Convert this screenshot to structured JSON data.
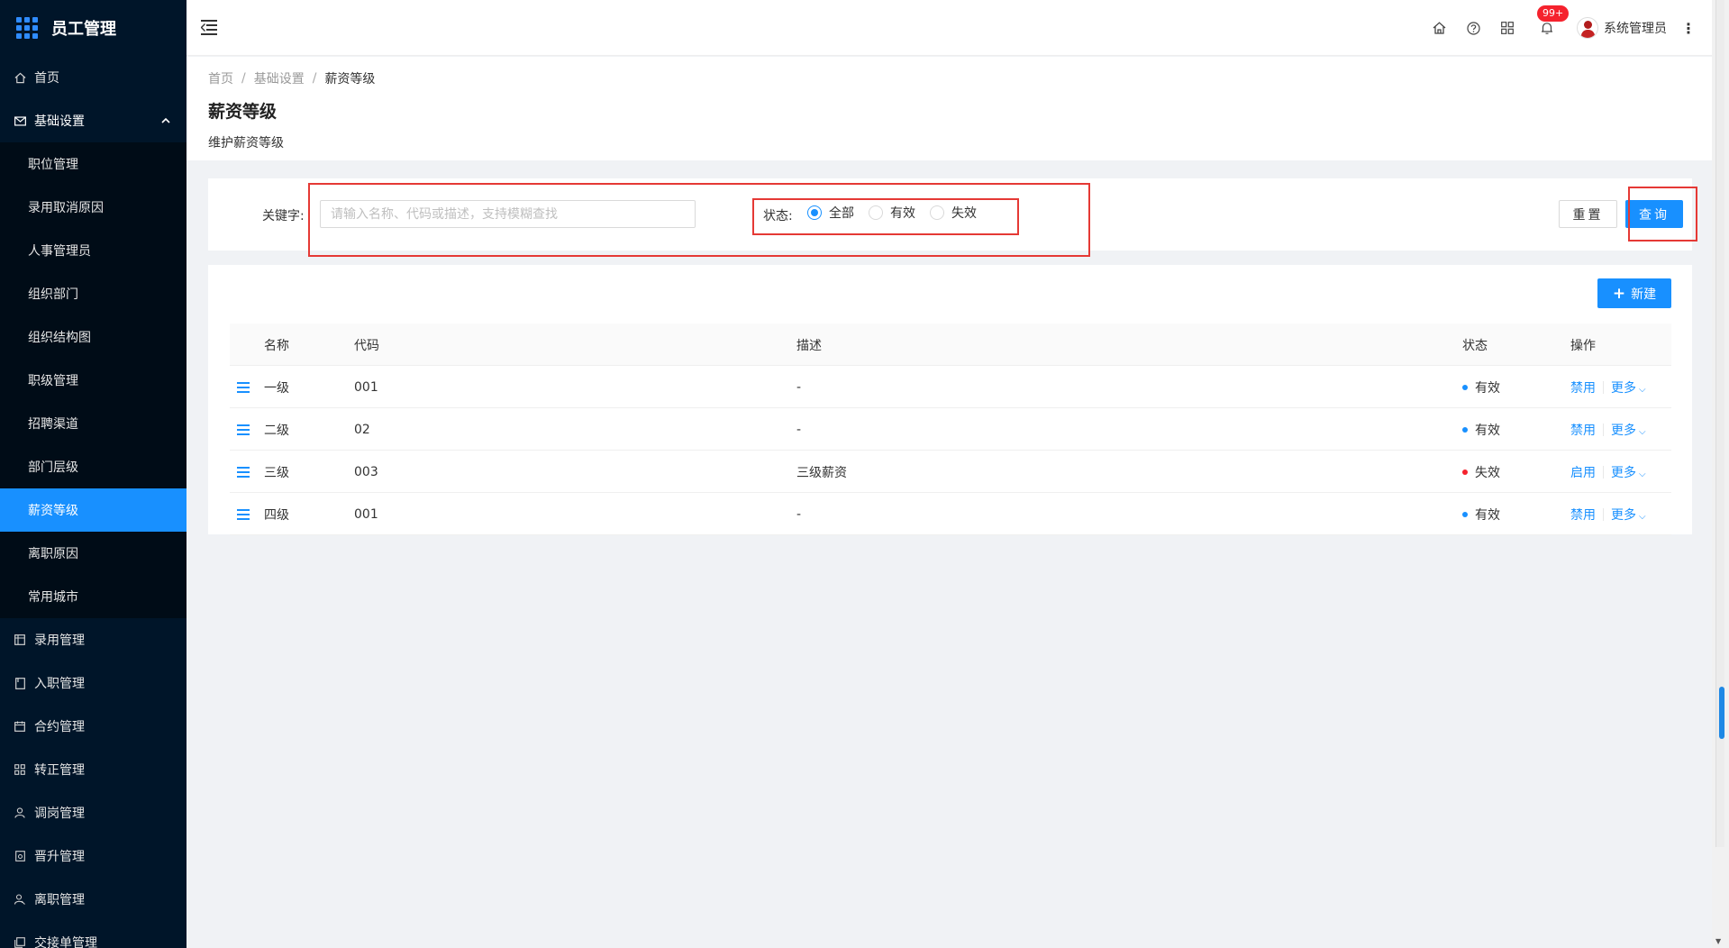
{
  "brand": {
    "title": "员工管理"
  },
  "sidebar": {
    "items": [
      {
        "key": "home",
        "label": "首页",
        "icon": "home-icon"
      },
      {
        "key": "basic",
        "label": "基础设置",
        "icon": "mail-icon",
        "open": true
      }
    ],
    "sub_items": [
      {
        "label": "职位管理"
      },
      {
        "label": "录用取消原因"
      },
      {
        "label": "人事管理员"
      },
      {
        "label": "组织部门"
      },
      {
        "label": "组织结构图"
      },
      {
        "label": "职级管理"
      },
      {
        "label": "招聘渠道"
      },
      {
        "label": "部门层级"
      },
      {
        "label": "薪资等级",
        "active": true
      },
      {
        "label": "离职原因"
      },
      {
        "label": "常用城市"
      }
    ],
    "bottom_items": [
      {
        "label": "录用管理",
        "icon": "calendar-icon"
      },
      {
        "label": "入职管理",
        "icon": "file-icon"
      },
      {
        "label": "合约管理",
        "icon": "calendar-icon"
      },
      {
        "label": "转正管理",
        "icon": "grid-icon"
      },
      {
        "label": "调岗管理",
        "icon": "user-icon"
      },
      {
        "label": "晋升管理",
        "icon": "doc-icon"
      },
      {
        "label": "离职管理",
        "icon": "user-leave-icon"
      },
      {
        "label": "交接单管理",
        "icon": "copy-icon"
      }
    ]
  },
  "header": {
    "notification_badge": "99+",
    "user_name": "系统管理员"
  },
  "breadcrumb": {
    "items": [
      "首页",
      "基础设置"
    ],
    "current": "薪资等级"
  },
  "page": {
    "title": "薪资等级",
    "description": "维护薪资等级"
  },
  "filter": {
    "keyword_label": "关键字:",
    "keyword_placeholder": "请输入名称、代码或描述，支持模糊查找",
    "keyword_value": "",
    "status_label": "状态:",
    "status_options": [
      "全部",
      "有效",
      "失效"
    ],
    "status_selected": "全部",
    "reset_label": "重置",
    "query_label": "查询"
  },
  "table": {
    "new_button_label": "新建",
    "columns": {
      "name": "名称",
      "code": "代码",
      "desc": "描述",
      "status": "状态",
      "ops": "操作"
    },
    "rows": [
      {
        "name": "一级",
        "code": "001",
        "desc": "-",
        "status": "有效",
        "status_color": "#1890ff",
        "toggle": "禁用",
        "more": "更多"
      },
      {
        "name": "二级",
        "code": "02",
        "desc": "-",
        "status": "有效",
        "status_color": "#1890ff",
        "toggle": "禁用",
        "more": "更多"
      },
      {
        "name": "三级",
        "code": "003",
        "desc": "三级薪资",
        "status": "失效",
        "status_color": "#f5222d",
        "toggle": "启用",
        "more": "更多"
      },
      {
        "name": "四级",
        "code": "001",
        "desc": "-",
        "status": "有效",
        "status_color": "#1890ff",
        "toggle": "禁用",
        "more": "更多"
      }
    ]
  },
  "colors": {
    "accent": "#1890ff",
    "sidebar_bg": "#001529",
    "highlight": "#e53935"
  }
}
